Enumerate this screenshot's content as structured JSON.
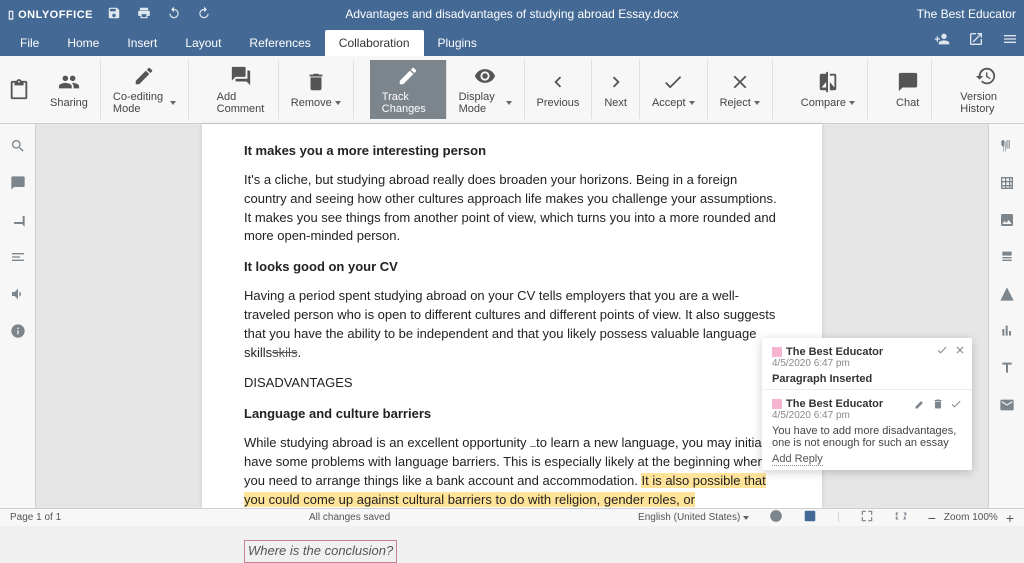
{
  "app": {
    "name": "ONLYOFFICE",
    "document_title": "Advantages and disadvantages of studying abroad Essay.docx",
    "user": "The Best Educator"
  },
  "menu": {
    "file": "File",
    "home": "Home",
    "insert": "Insert",
    "layout": "Layout",
    "references": "References",
    "collaboration": "Collaboration",
    "plugins": "Plugins"
  },
  "ribbon": {
    "sharing": "Sharing",
    "coediting": "Co-editing Mode",
    "add_comment": "Add Comment",
    "remove": "Remove",
    "track_changes": "Track Changes",
    "display_mode": "Display Mode",
    "previous": "Previous",
    "next": "Next",
    "accept": "Accept",
    "reject": "Reject",
    "compare": "Compare",
    "chat": "Chat",
    "version_history": "Version History"
  },
  "doc": {
    "h1": "It makes you a more interesting person",
    "p1": "It's a cliche, but studying abroad really does broaden your horizons. Being in a foreign country and seeing how other cultures approach life makes you challenge your assumptions. It makes you see things from another point of view, which turns you into a more rounded and more open-minded person.",
    "h2": "It looks good on your CV",
    "p2a": "Having a period spent studying abroad on your CV tells employers that you are a well-traveled person who is open to different cultures and different points of view. It also suggests that you have the ability to be independent and that you likely possess valuable language skills",
    "p2_strike": "skils",
    "p2b": ".",
    "h3": "DISADVANTAGES",
    "h4": "Language and culture barriers",
    "p3a": "While studying abroad is an excellent opportunity ",
    "p3b": "to learn a new language, you may initially have some problems with language barriers. This is especially likely at the beginning when you need to arrange things like a bank account and accommodation. ",
    "p3_hl": "It is also possible that you could come up against cultural barriers to do with religion, gender roles, or communication differences.",
    "p4_ins": "Where is the conclusion?"
  },
  "popup": {
    "r1": {
      "author": "The Best Educator",
      "date": "4/5/2020 6:47 pm",
      "title": "Paragraph Inserted"
    },
    "r2": {
      "author": "The Best Educator",
      "date": "4/5/2020 6:47 pm",
      "body": "You have to add more disadvantages, one is not enough for such an essay",
      "reply": "Add Reply"
    }
  },
  "status": {
    "page": "Page 1 of 1",
    "saved": "All changes saved",
    "lang": "English (United States)",
    "zoom": "Zoom 100%"
  }
}
